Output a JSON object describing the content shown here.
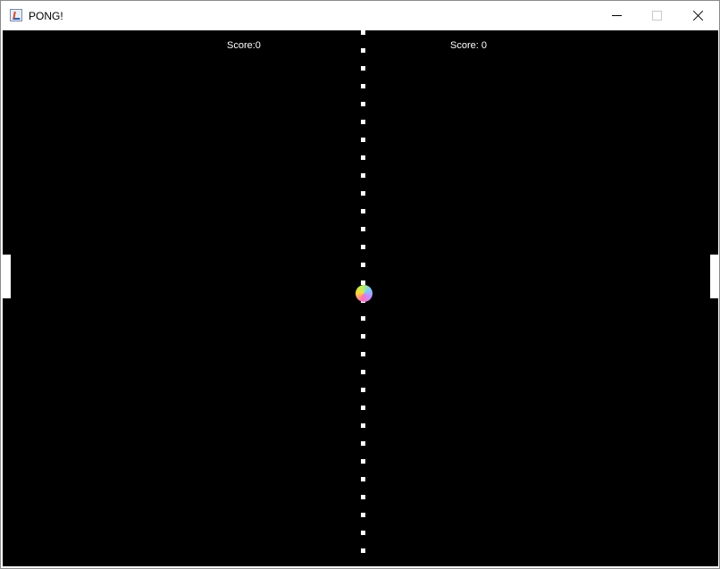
{
  "window": {
    "title": "PONG!",
    "app_icon": "java-icon",
    "controls": [
      "minimize-icon",
      "maximize-icon",
      "close-icon"
    ]
  },
  "game": {
    "left_score_text": "Score:0",
    "right_score_text": "Score: 0",
    "left_score": 0,
    "right_score": 0,
    "background_color": "#000000",
    "foreground_color": "#ffffff",
    "ball_colors": [
      "#ff6fb0",
      "#ffd43a",
      "#b9f25a",
      "#7ec8ff",
      "#c58bff"
    ]
  }
}
